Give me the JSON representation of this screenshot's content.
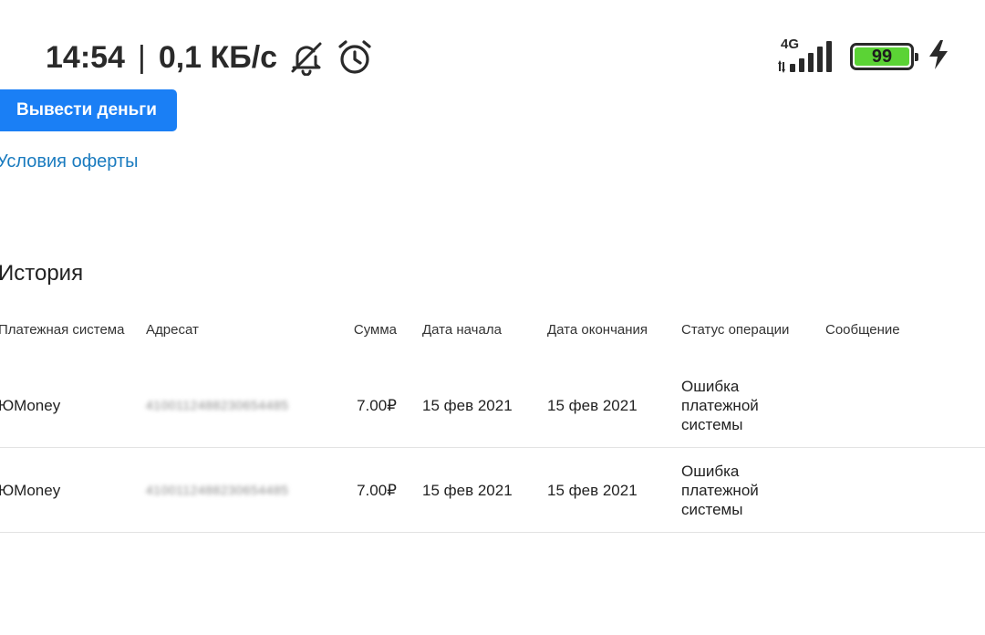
{
  "status_bar": {
    "time": "14:54",
    "separator": "|",
    "speed": "0,1 КБ/с",
    "network": "4G",
    "battery": "99",
    "icons": [
      "bell-off-icon",
      "alarm-icon",
      "signal-icon",
      "battery-icon",
      "charging-icon"
    ],
    "battery_color": "#5bd335"
  },
  "actions": {
    "withdraw_label": "Вывести деньги",
    "offer_link": "Условия оферты"
  },
  "history": {
    "title": "История",
    "columns": [
      "Платежная система",
      "Адресат",
      "Сумма",
      "Дата начала",
      "Дата окончания",
      "Статус операции",
      "Сообщение"
    ],
    "rows": [
      {
        "system": "ЮMoney",
        "recipient": "4100112488230654485",
        "amount": "7.00₽",
        "start": "15 фев 2021",
        "end": "15 фев 2021",
        "status": "Ошибка платежной системы",
        "message": ""
      },
      {
        "system": "ЮMoney",
        "recipient": "4100112488230654485",
        "amount": "7.00₽",
        "start": "15 фев 2021",
        "end": "15 фев 2021",
        "status": "Ошибка платежной системы",
        "message": ""
      }
    ]
  },
  "colors": {
    "primary_button": "#1a7ff5",
    "link": "#1a7bbf"
  }
}
